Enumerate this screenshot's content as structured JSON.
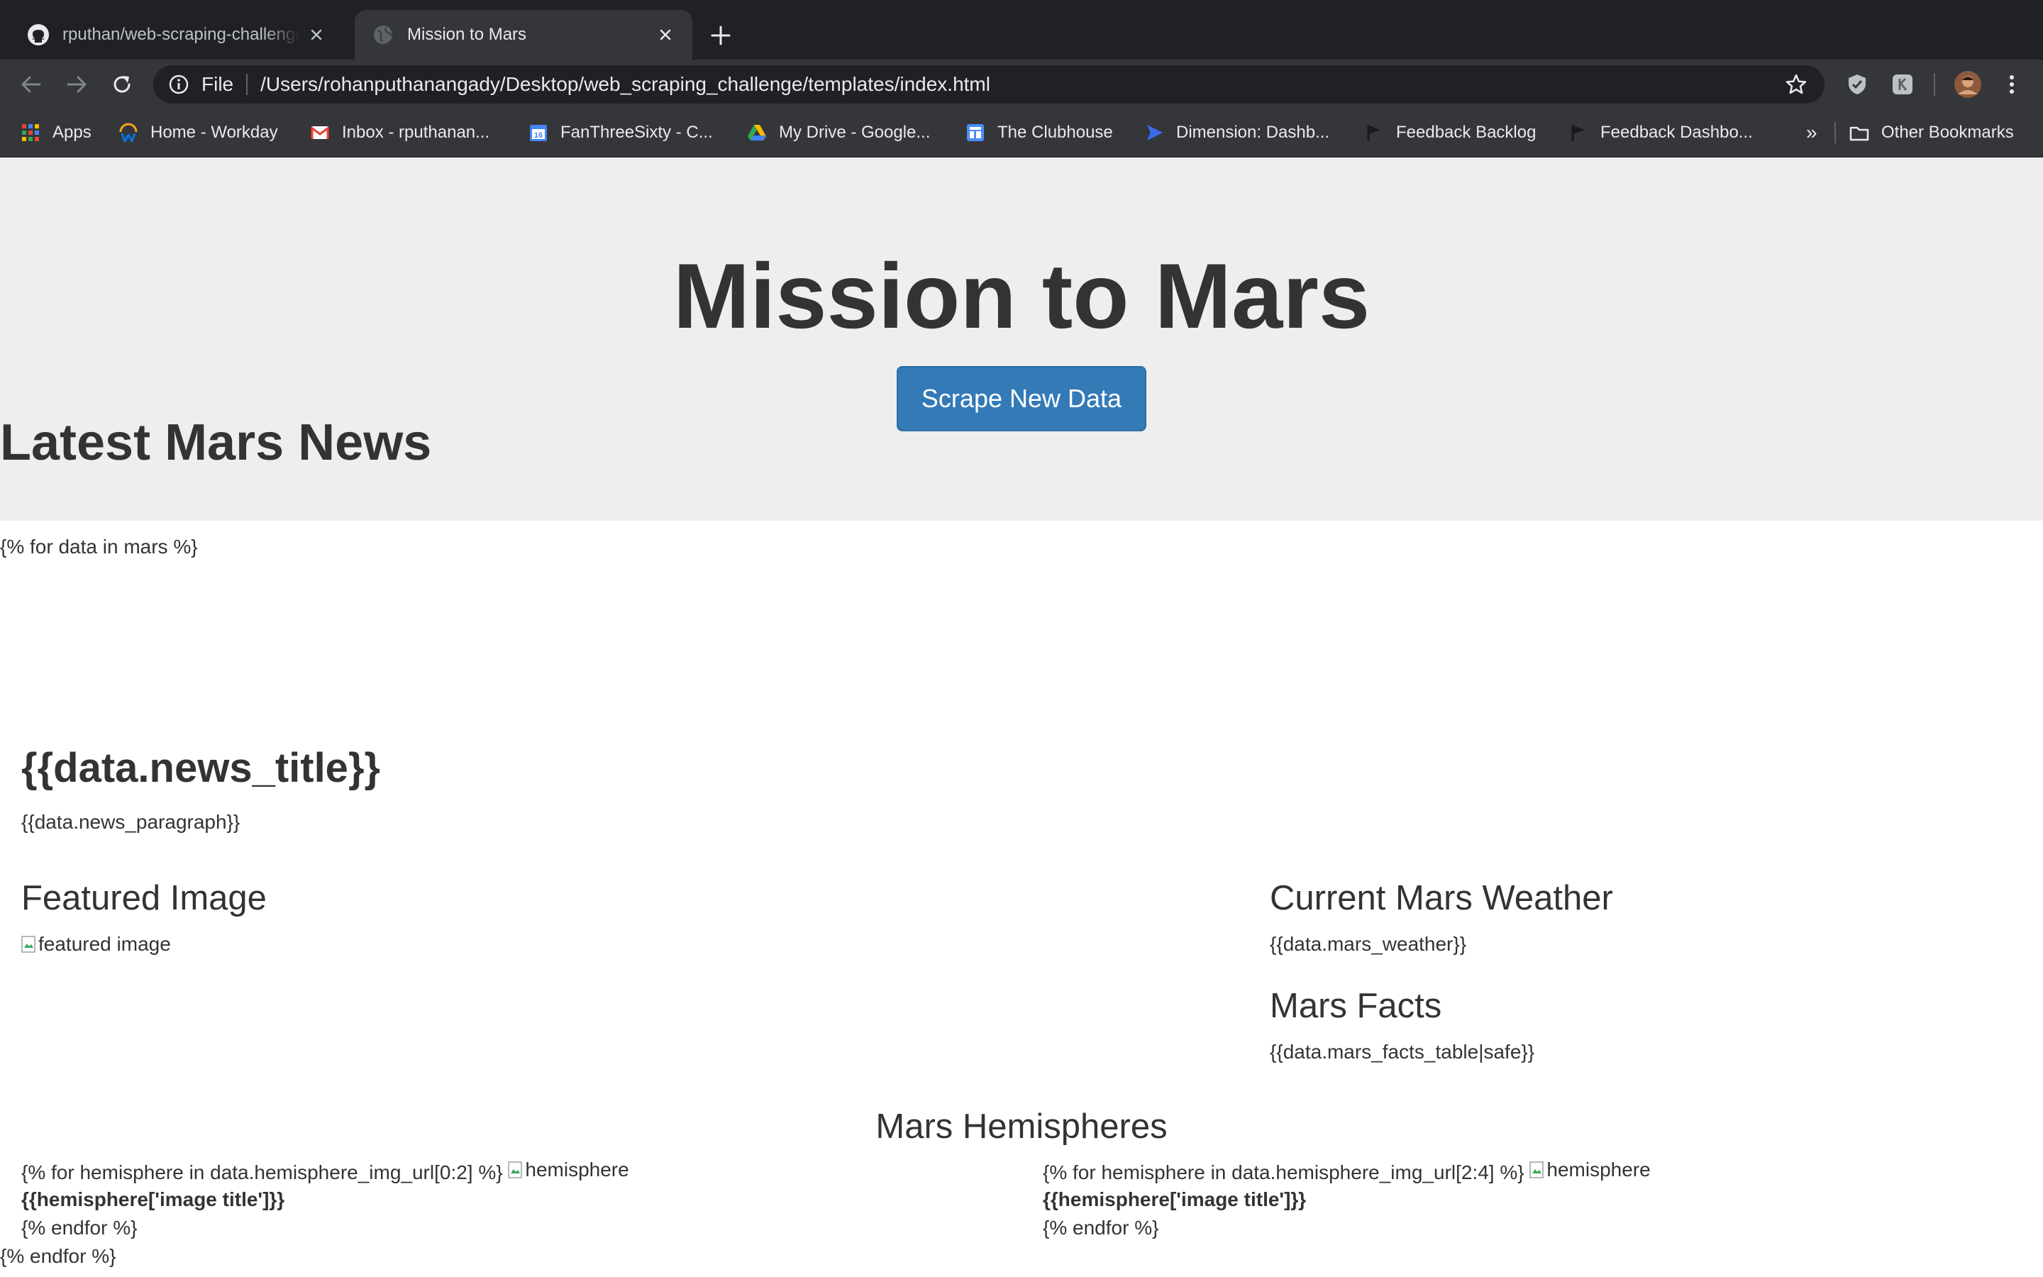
{
  "browser": {
    "tabs": [
      {
        "title": "rputhan/web-scraping-challenge",
        "icon": "github-icon",
        "active": false
      },
      {
        "title": "Mission to Mars",
        "icon": "globe-icon",
        "active": true
      }
    ],
    "address_bar": {
      "scheme_label": "File",
      "url": "/Users/rohanputhanangady/Desktop/web_scraping_challenge/templates/index.html"
    },
    "bookmarks": [
      {
        "label": "Apps",
        "icon": "apps-grid-icon"
      },
      {
        "label": "Home - Workday",
        "icon": "workday-icon"
      },
      {
        "label": "Inbox - rputhanan...",
        "icon": "gmail-icon"
      },
      {
        "label": "FanThreeSixty - C...",
        "icon": "calendar-icon",
        "icon_text": "16"
      },
      {
        "label": "My Drive - Google...",
        "icon": "google-drive-icon"
      },
      {
        "label": "The Clubhouse",
        "icon": "clubhouse-icon"
      },
      {
        "label": "Dimension: Dashb...",
        "icon": "dimension-icon"
      },
      {
        "label": "Feedback Backlog",
        "icon": "flag-icon"
      },
      {
        "label": "Feedback Dashbo...",
        "icon": "flag-icon"
      }
    ],
    "bookmarks_overflow": "»",
    "other_bookmarks": "Other Bookmarks"
  },
  "page": {
    "jumbotron": {
      "title": "Mission to Mars",
      "button_label": "Scrape New Data",
      "button_color": "#337ab7"
    },
    "news": {
      "heading": "Latest Mars News",
      "loop_start": "{% for data in mars %}",
      "title": "{{data.news_title}}",
      "paragraph": "{{data.news_paragraph}}"
    },
    "featured": {
      "heading": "Featured Image",
      "img_alt": "featured image"
    },
    "weather": {
      "heading": "Current Mars Weather",
      "value": "{{data.mars_weather}}"
    },
    "facts": {
      "heading": "Mars Facts",
      "value": "{{data.mars_facts_table|safe}}"
    },
    "hemispheres": {
      "heading": "Mars Hemispheres",
      "columns": [
        {
          "loop": "{% for hemisphere in data.hemisphere_img_url[0:2] %}",
          "img_alt": "hemisphere",
          "title": "{{hemisphere['image title']}}",
          "endfor": "{% endfor %}"
        },
        {
          "loop": "{% for hemisphere in data.hemisphere_img_url[2:4] %}",
          "img_alt": "hemisphere",
          "title": "{{hemisphere['image title']}}",
          "endfor": "{% endfor %}"
        }
      ]
    },
    "loop_end": "{% endfor %}"
  }
}
